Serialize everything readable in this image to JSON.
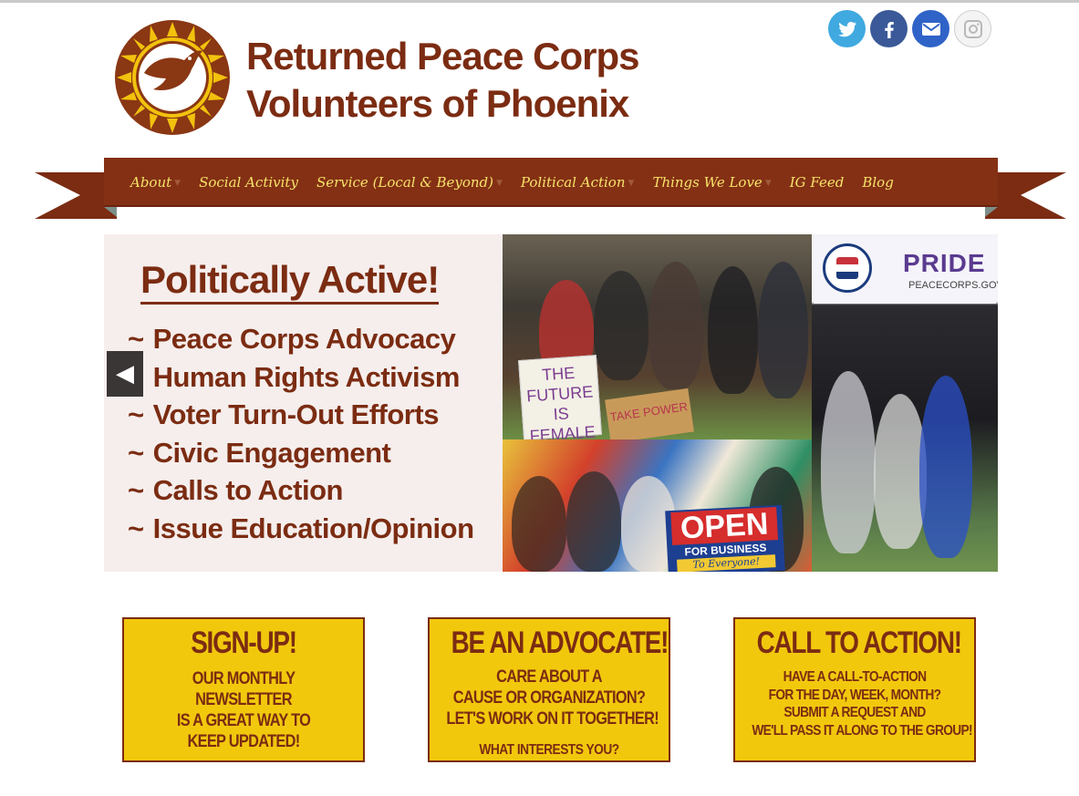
{
  "header": {
    "title_line1": "Returned Peace Corps",
    "title_line2": "Volunteers of Phoenix"
  },
  "social": [
    {
      "name": "twitter-icon"
    },
    {
      "name": "facebook-icon"
    },
    {
      "name": "email-icon"
    },
    {
      "name": "instagram-icon"
    }
  ],
  "nav": {
    "items": [
      {
        "label": "About"
      },
      {
        "label": "Social Activity"
      },
      {
        "label": "Service (Local & Beyond)"
      },
      {
        "label": "Political Action"
      },
      {
        "label": "Things We Love"
      },
      {
        "label": "IG Feed"
      },
      {
        "label": "Blog"
      }
    ]
  },
  "slider": {
    "heading": "Politically Active!",
    "list": [
      "Peace Corps Advocacy",
      "Human Rights Activism",
      "Voter Turn-Out Efforts",
      "Civic Engagement",
      "Calls to Action",
      "Issue Education/Opinion"
    ],
    "bullet": "~",
    "prev_arrow": "◀",
    "photo_signs": {
      "future": "THE FUTURE IS FEMALE",
      "back": "TAKE POWER BACK!",
      "open": "OPEN",
      "open_sub": "FOR BUSINESS",
      "open_everyone": "To Everyone!",
      "pride": "PRIDE",
      "pride_url": "PEACECORPS.GOV"
    }
  },
  "callouts": {
    "signup": {
      "title": "SIGN-UP!",
      "lines": [
        "OUR MONTHLY",
        "NEWSLETTER",
        "IS A GREAT WAY TO",
        "KEEP UPDATED!"
      ]
    },
    "advocate": {
      "title": "BE AN ADVOCATE!",
      "lines": [
        "CARE ABOUT A",
        "CAUSE OR ORGANIZATION?",
        "LET'S WORK ON IT TOGETHER!"
      ],
      "question": "WHAT INTERESTS YOU?"
    },
    "action": {
      "title": "CALL TO ACTION!",
      "lines": [
        "HAVE A CALL-TO-ACTION",
        "FOR THE DAY, WEEK, MONTH?",
        "SUBMIT A REQUEST AND",
        "WE'LL PASS IT ALONG TO THE GROUP!"
      ]
    }
  },
  "colors": {
    "brand_brown": "#7b2c12",
    "nav_text": "#f6e36a",
    "callout_yellow": "#f2c80d"
  }
}
